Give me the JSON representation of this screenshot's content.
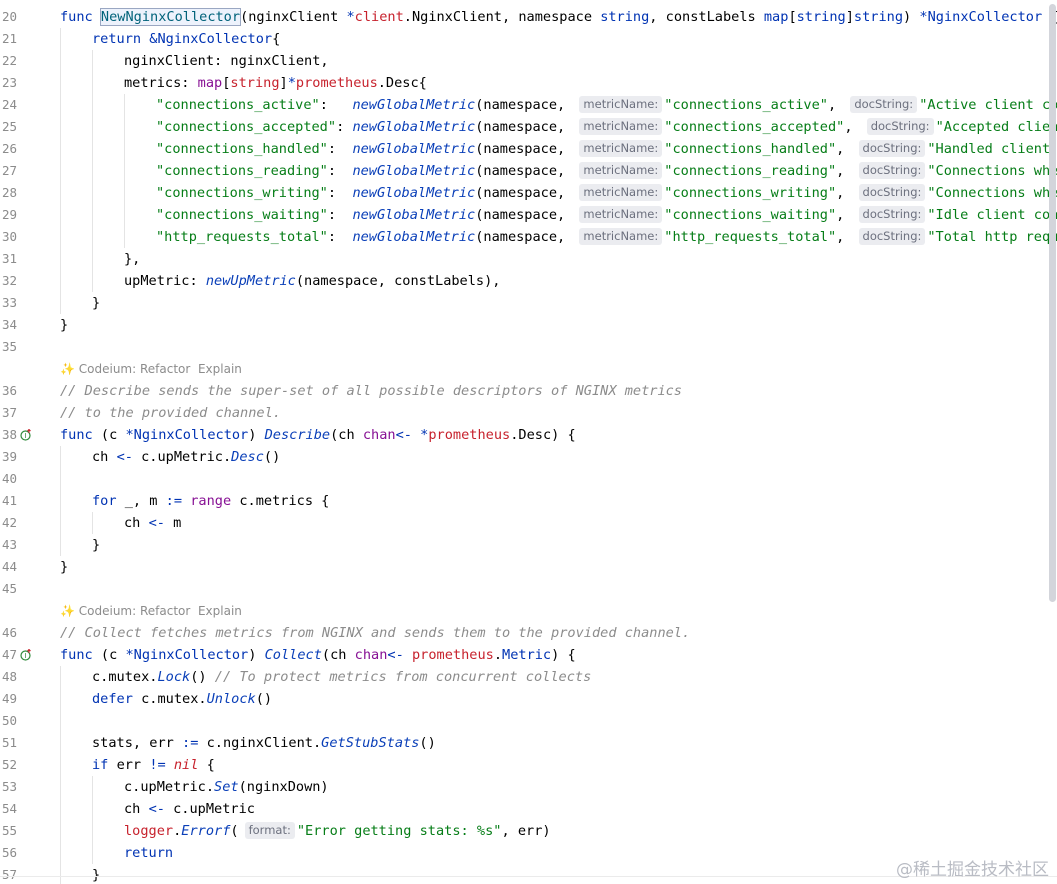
{
  "editor": {
    "lines": [
      {
        "num": "20",
        "icon": "",
        "parts": [
          {
            "t": "func ",
            "c": "kw"
          },
          {
            "t": "NewNginxCollector",
            "c": "fn-def sel"
          },
          {
            "t": "(nginxClient ",
            "c": "type"
          },
          {
            "t": "*",
            "c": "op"
          },
          {
            "t": "client",
            "c": "pkg"
          },
          {
            "t": ".NginxClient, namespace ",
            "c": "type"
          },
          {
            "t": "string",
            "c": "kw"
          },
          {
            "t": ", constLabels ",
            "c": "type"
          },
          {
            "t": "map",
            "c": "kw"
          },
          {
            "t": "[",
            "c": "type"
          },
          {
            "t": "string",
            "c": "kw"
          },
          {
            "t": "]",
            "c": "type"
          },
          {
            "t": "string",
            "c": "kw"
          },
          {
            "t": ") ",
            "c": "type"
          },
          {
            "t": "*NginxCollector",
            "c": "kw"
          },
          {
            "t": " {",
            "c": "type"
          }
        ]
      },
      {
        "num": "21",
        "icon": "",
        "indent": 1,
        "parts": [
          {
            "t": "return ",
            "c": "kw"
          },
          {
            "t": "&NginxCollector",
            "c": "kw"
          },
          {
            "t": "{",
            "c": "type"
          }
        ]
      },
      {
        "num": "22",
        "icon": "",
        "indent": 2,
        "parts": [
          {
            "t": "nginxClient: nginxClient,",
            "c": "type"
          }
        ]
      },
      {
        "num": "23",
        "icon": "",
        "indent": 2,
        "parts": [
          {
            "t": "metrics: ",
            "c": "type"
          },
          {
            "t": "map",
            "c": "typkw"
          },
          {
            "t": "[",
            "c": "type"
          },
          {
            "t": "string",
            "c": "pkg"
          },
          {
            "t": "]",
            "c": "type"
          },
          {
            "t": "*",
            "c": "op"
          },
          {
            "t": "prometheus",
            "c": "pkg"
          },
          {
            "t": ".Desc{",
            "c": "type"
          }
        ]
      },
      {
        "num": "24",
        "icon": "",
        "indent": 3,
        "parts": [
          {
            "t": "\"connections_active\"",
            "c": "str"
          },
          {
            "t": ":   ",
            "c": "type"
          },
          {
            "t": "newGlobalMetric",
            "c": "glob"
          },
          {
            "t": "(namespace, ",
            "c": "type"
          },
          {
            "hint": "metricName:"
          },
          {
            "t": "\"connections_active\"",
            "c": "str"
          },
          {
            "t": ", ",
            "c": "type"
          },
          {
            "hint": "docString:"
          },
          {
            "t": "\"Active client connections\"",
            "c": "str"
          }
        ]
      },
      {
        "num": "25",
        "icon": "",
        "indent": 3,
        "parts": [
          {
            "t": "\"connections_accepted\"",
            "c": "str"
          },
          {
            "t": ": ",
            "c": "type"
          },
          {
            "t": "newGlobalMetric",
            "c": "glob"
          },
          {
            "t": "(namespace, ",
            "c": "type"
          },
          {
            "hint": "metricName:"
          },
          {
            "t": "\"connections_accepted\"",
            "c": "str"
          },
          {
            "t": ", ",
            "c": "type"
          },
          {
            "hint": "docString:"
          },
          {
            "t": "\"Accepted client connections\"",
            "c": "str"
          }
        ]
      },
      {
        "num": "26",
        "icon": "",
        "indent": 3,
        "parts": [
          {
            "t": "\"connections_handled\"",
            "c": "str"
          },
          {
            "t": ":  ",
            "c": "type"
          },
          {
            "t": "newGlobalMetric",
            "c": "glob"
          },
          {
            "t": "(namespace, ",
            "c": "type"
          },
          {
            "hint": "metricName:"
          },
          {
            "t": "\"connections_handled\"",
            "c": "str"
          },
          {
            "t": ", ",
            "c": "type"
          },
          {
            "hint": "docString:"
          },
          {
            "t": "\"Handled client connections\"",
            "c": "str"
          }
        ]
      },
      {
        "num": "27",
        "icon": "",
        "indent": 3,
        "parts": [
          {
            "t": "\"connections_reading\"",
            "c": "str"
          },
          {
            "t": ":  ",
            "c": "type"
          },
          {
            "t": "newGlobalMetric",
            "c": "glob"
          },
          {
            "t": "(namespace, ",
            "c": "type"
          },
          {
            "hint": "metricName:"
          },
          {
            "t": "\"connections_reading\"",
            "c": "str"
          },
          {
            "t": ", ",
            "c": "type"
          },
          {
            "hint": "docString:"
          },
          {
            "t": "\"Connections where NGINX is reading\"",
            "c": "str"
          }
        ]
      },
      {
        "num": "28",
        "icon": "",
        "indent": 3,
        "parts": [
          {
            "t": "\"connections_writing\"",
            "c": "str"
          },
          {
            "t": ":  ",
            "c": "type"
          },
          {
            "t": "newGlobalMetric",
            "c": "glob"
          },
          {
            "t": "(namespace, ",
            "c": "type"
          },
          {
            "hint": "metricName:"
          },
          {
            "t": "\"connections_writing\"",
            "c": "str"
          },
          {
            "t": ", ",
            "c": "type"
          },
          {
            "hint": "docString:"
          },
          {
            "t": "\"Connections where NGINX is writing\"",
            "c": "str"
          }
        ]
      },
      {
        "num": "29",
        "icon": "",
        "indent": 3,
        "parts": [
          {
            "t": "\"connections_waiting\"",
            "c": "str"
          },
          {
            "t": ":  ",
            "c": "type"
          },
          {
            "t": "newGlobalMetric",
            "c": "glob"
          },
          {
            "t": "(namespace, ",
            "c": "type"
          },
          {
            "hint": "metricName:"
          },
          {
            "t": "\"connections_waiting\"",
            "c": "str"
          },
          {
            "t": ", ",
            "c": "type"
          },
          {
            "hint": "docString:"
          },
          {
            "t": "\"Idle client connections\"",
            "c": "str"
          }
        ]
      },
      {
        "num": "30",
        "icon": "",
        "indent": 3,
        "parts": [
          {
            "t": "\"http_requests_total\"",
            "c": "str"
          },
          {
            "t": ":  ",
            "c": "type"
          },
          {
            "t": "newGlobalMetric",
            "c": "glob"
          },
          {
            "t": "(namespace, ",
            "c": "type"
          },
          {
            "hint": "metricName:"
          },
          {
            "t": "\"http_requests_total\"",
            "c": "str"
          },
          {
            "t": ", ",
            "c": "type"
          },
          {
            "hint": "docString:"
          },
          {
            "t": "\"Total http requests\"",
            "c": "str"
          }
        ]
      },
      {
        "num": "31",
        "icon": "",
        "indent": 2,
        "parts": [
          {
            "t": "},",
            "c": "type"
          }
        ]
      },
      {
        "num": "32",
        "icon": "",
        "indent": 2,
        "parts": [
          {
            "t": "upMetric: ",
            "c": "type"
          },
          {
            "t": "newUpMetric",
            "c": "glob"
          },
          {
            "t": "(namespace, constLabels),",
            "c": "type"
          }
        ]
      },
      {
        "num": "33",
        "icon": "",
        "indent": 1,
        "parts": [
          {
            "t": "}",
            "c": "type"
          }
        ]
      },
      {
        "num": "34",
        "icon": "",
        "parts": [
          {
            "t": "}",
            "c": "type"
          }
        ]
      },
      {
        "num": "35",
        "icon": "",
        "parts": []
      },
      {
        "codeium": true,
        "label": "Codeium: Refactor",
        "action": "Explain"
      },
      {
        "num": "36",
        "icon": "",
        "parts": [
          {
            "t": "// Describe sends the super-set of all possible descriptors of NGINX metrics",
            "c": "cm"
          }
        ]
      },
      {
        "num": "37",
        "icon": "",
        "parts": [
          {
            "t": "// to the provided channel.",
            "c": "cm"
          }
        ]
      },
      {
        "num": "38",
        "icon": "implements",
        "parts": [
          {
            "t": "func ",
            "c": "kw"
          },
          {
            "t": "(c ",
            "c": "type"
          },
          {
            "t": "*NginxCollector",
            "c": "kw"
          },
          {
            "t": ") ",
            "c": "type"
          },
          {
            "t": "Describe",
            "c": "glob"
          },
          {
            "t": "(ch ",
            "c": "type"
          },
          {
            "t": "chan",
            "c": "typkw"
          },
          {
            "t": "<- ",
            "c": "op"
          },
          {
            "t": "*",
            "c": "op"
          },
          {
            "t": "prometheus",
            "c": "pkg"
          },
          {
            "t": ".Desc) {",
            "c": "type"
          }
        ]
      },
      {
        "num": "39",
        "icon": "",
        "indent": 1,
        "parts": [
          {
            "t": "ch ",
            "c": "type"
          },
          {
            "t": "<-",
            "c": "op"
          },
          {
            "t": " c.upMetric.",
            "c": "type"
          },
          {
            "t": "Desc",
            "c": "glob"
          },
          {
            "t": "()",
            "c": "type"
          }
        ]
      },
      {
        "num": "40",
        "icon": "",
        "indent": 1,
        "parts": []
      },
      {
        "num": "41",
        "icon": "",
        "indent": 1,
        "parts": [
          {
            "t": "for ",
            "c": "kw"
          },
          {
            "t": "_, m ",
            "c": "type"
          },
          {
            "t": ":=",
            "c": "op"
          },
          {
            "t": " ",
            "c": "type"
          },
          {
            "t": "range",
            "c": "typkw"
          },
          {
            "t": " c.metrics {",
            "c": "type"
          }
        ]
      },
      {
        "num": "42",
        "icon": "",
        "indent": 2,
        "parts": [
          {
            "t": "ch ",
            "c": "type"
          },
          {
            "t": "<-",
            "c": "op"
          },
          {
            "t": " m",
            "c": "type"
          }
        ]
      },
      {
        "num": "43",
        "icon": "",
        "indent": 1,
        "parts": [
          {
            "t": "}",
            "c": "type"
          }
        ]
      },
      {
        "num": "44",
        "icon": "",
        "parts": [
          {
            "t": "}",
            "c": "type"
          }
        ]
      },
      {
        "num": "45",
        "icon": "",
        "parts": []
      },
      {
        "codeium": true,
        "label": "Codeium: Refactor",
        "action": "Explain"
      },
      {
        "num": "46",
        "icon": "",
        "parts": [
          {
            "t": "// Collect fetches metrics from NGINX and sends them to the provided channel.",
            "c": "cm"
          }
        ]
      },
      {
        "num": "47",
        "icon": "implements",
        "parts": [
          {
            "t": "func ",
            "c": "kw"
          },
          {
            "t": "(c ",
            "c": "type"
          },
          {
            "t": "*NginxCollector",
            "c": "kw"
          },
          {
            "t": ") ",
            "c": "type"
          },
          {
            "t": "Collect",
            "c": "glob"
          },
          {
            "t": "(ch ",
            "c": "type"
          },
          {
            "t": "chan",
            "c": "typkw"
          },
          {
            "t": "<- ",
            "c": "op"
          },
          {
            "t": "prometheus",
            "c": "pkg"
          },
          {
            "t": ".",
            "c": "type"
          },
          {
            "t": "Metric",
            "c": "kw"
          },
          {
            "t": ") {",
            "c": "type"
          }
        ]
      },
      {
        "num": "48",
        "icon": "",
        "indent": 1,
        "parts": [
          {
            "t": "c.mutex.",
            "c": "type"
          },
          {
            "t": "Lock",
            "c": "glob"
          },
          {
            "t": "() ",
            "c": "type"
          },
          {
            "t": "// To protect metrics from concurrent collects",
            "c": "cm"
          }
        ]
      },
      {
        "num": "49",
        "icon": "",
        "indent": 1,
        "parts": [
          {
            "t": "defer ",
            "c": "kw"
          },
          {
            "t": "c.mutex.",
            "c": "type"
          },
          {
            "t": "Unlock",
            "c": "glob"
          },
          {
            "t": "()",
            "c": "type"
          }
        ]
      },
      {
        "num": "50",
        "icon": "",
        "indent": 1,
        "parts": []
      },
      {
        "num": "51",
        "icon": "",
        "indent": 1,
        "parts": [
          {
            "t": "stats, err ",
            "c": "type"
          },
          {
            "t": ":=",
            "c": "op"
          },
          {
            "t": " c.nginxClient.",
            "c": "type"
          },
          {
            "t": "GetStubStats",
            "c": "glob"
          },
          {
            "t": "()",
            "c": "type"
          }
        ]
      },
      {
        "num": "52",
        "icon": "",
        "indent": 1,
        "parts": [
          {
            "t": "if ",
            "c": "kw"
          },
          {
            "t": "err ",
            "c": "type"
          },
          {
            "t": "!=",
            "c": "op"
          },
          {
            "t": " ",
            "c": "type"
          },
          {
            "t": "nil",
            "c": "nil"
          },
          {
            "t": " {",
            "c": "type"
          }
        ]
      },
      {
        "num": "53",
        "icon": "",
        "indent": 2,
        "parts": [
          {
            "t": "c.upMetric.",
            "c": "type"
          },
          {
            "t": "Set",
            "c": "glob"
          },
          {
            "t": "(nginxDown)",
            "c": "type"
          }
        ]
      },
      {
        "num": "54",
        "icon": "",
        "indent": 2,
        "parts": [
          {
            "t": "ch ",
            "c": "type"
          },
          {
            "t": "<-",
            "c": "op"
          },
          {
            "t": " c.upMetric",
            "c": "type"
          }
        ]
      },
      {
        "num": "55",
        "icon": "",
        "indent": 2,
        "parts": [
          {
            "t": "logger",
            "c": "pkg"
          },
          {
            "t": ".",
            "c": "type"
          },
          {
            "t": "Errorf",
            "c": "glob"
          },
          {
            "t": "(",
            "c": "type"
          },
          {
            "hint": "format:"
          },
          {
            "t": "\"Error getting stats: %s\"",
            "c": "str"
          },
          {
            "t": ", err)",
            "c": "type"
          }
        ]
      },
      {
        "num": "56",
        "icon": "",
        "indent": 2,
        "parts": [
          {
            "t": "return",
            "c": "kw"
          }
        ]
      },
      {
        "num": "57",
        "icon": "",
        "indent": 1,
        "parts": [
          {
            "t": "}",
            "c": "type"
          }
        ]
      }
    ]
  },
  "watermark": "@稀土掘金技术社区",
  "colors": {
    "keyword": "#0033b3",
    "string": "#067d17",
    "comment": "#8c8c8c",
    "package": "#c7222d",
    "gutter_icon": "#2f8a3a"
  }
}
